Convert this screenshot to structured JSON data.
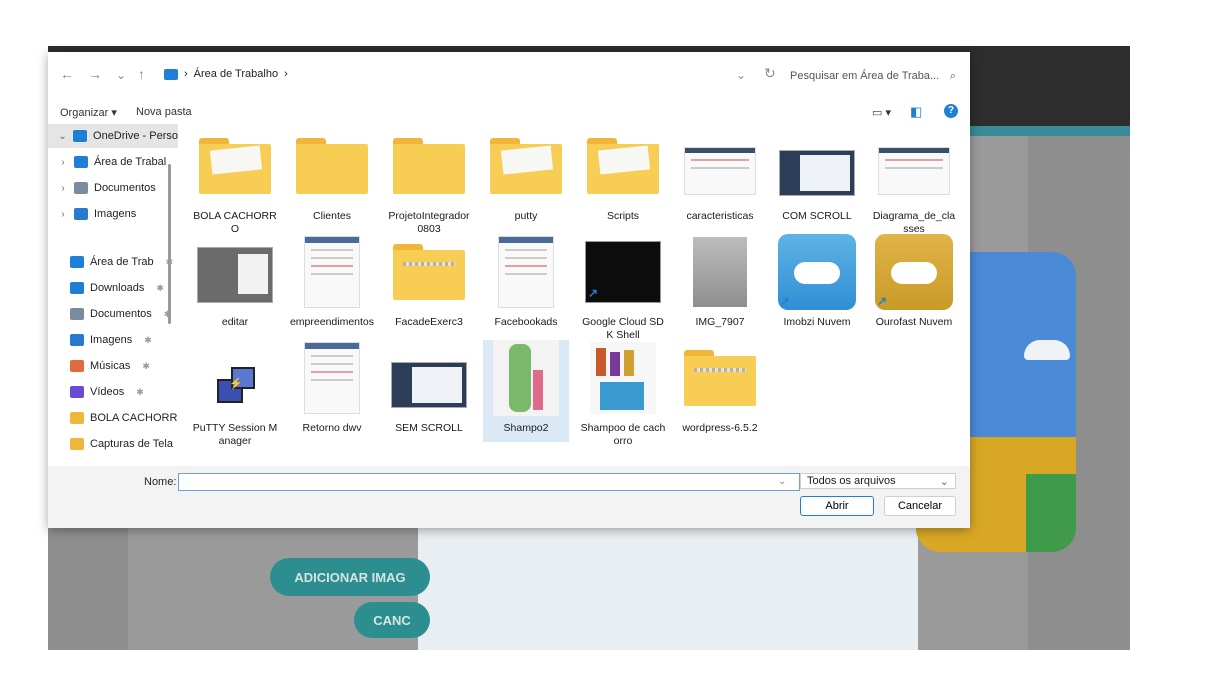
{
  "background_app": {
    "button_add": "ADICIONAR IMAG",
    "button_cancel": "CANC"
  },
  "nav": {
    "back": "←",
    "forward": "→",
    "recent": "⌄",
    "up": "↑",
    "breadcrumb_sep": "›",
    "breadcrumb": "Área de Trabalho",
    "dropdown": "⌄",
    "refresh": "↻",
    "search_placeholder": "Pesquisar em Área de Traba...",
    "search_icon": "⌕"
  },
  "toolbar": {
    "organize": "Organizar ▾",
    "new_folder": "Nova pasta",
    "view_icon": "▭ ▾",
    "preview_icon": "◧",
    "help_icon": "?"
  },
  "sidebar": {
    "items": [
      {
        "label": "OneDrive - Perso",
        "chev": "⌄",
        "icon": "onedrive-icon",
        "color": "#1f7fd6",
        "selected": true
      },
      {
        "label": "Área de Trabal",
        "chev": "›",
        "icon": "desktop-icon",
        "color": "#1f7fd6"
      },
      {
        "label": "Documentos",
        "chev": "›",
        "icon": "documents-icon",
        "color": "#7a8ba0"
      },
      {
        "label": "Imagens",
        "chev": "›",
        "icon": "images-icon",
        "color": "#2a79d0"
      },
      {
        "label": "Área de Trab",
        "pin": "📌",
        "icon": "desktop-icon",
        "color": "#1f7fd6"
      },
      {
        "label": "Downloads",
        "pin": "📌",
        "icon": "downloads-icon",
        "color": "#1f7fd6"
      },
      {
        "label": "Documentos",
        "pin": "📌",
        "icon": "documents-icon",
        "color": "#7a8ba0"
      },
      {
        "label": "Imagens",
        "pin": "📌",
        "icon": "images-icon",
        "color": "#2a79d0"
      },
      {
        "label": "Músicas",
        "pin": "📌",
        "icon": "music-icon",
        "color": "#e06a3b"
      },
      {
        "label": "Vídeos",
        "pin": "📌",
        "icon": "videos-icon",
        "color": "#6a4bd1"
      },
      {
        "label": "BOLA CACHORR",
        "icon": "folder-icon",
        "color": "#f0b63a"
      },
      {
        "label": "Capturas de Tela",
        "icon": "folder-icon",
        "color": "#f0b63a"
      }
    ]
  },
  "files": [
    {
      "label": "BOLA CACHORRO",
      "kind": "folder-paper"
    },
    {
      "label": "Clientes",
      "kind": "folder"
    },
    {
      "label": "ProjetoIntegrador0803",
      "kind": "folder"
    },
    {
      "label": "putty",
      "kind": "folder-paper"
    },
    {
      "label": "Scripts",
      "kind": "folder-paper"
    },
    {
      "label": "caracteristicas",
      "kind": "doc"
    },
    {
      "label": "COM SCROLL",
      "kind": "screenshot"
    },
    {
      "label": "Diagrama_de_classes",
      "kind": "doc"
    },
    {
      "label": "editar",
      "kind": "screenshot-gray"
    },
    {
      "label": "empreendimentos",
      "kind": "doc-tall"
    },
    {
      "label": "FacadeExerc3",
      "kind": "zip"
    },
    {
      "label": "Facebookads",
      "kind": "doc-tall"
    },
    {
      "label": "Google Cloud SDK Shell",
      "kind": "terminal",
      "shortcut": "↗"
    },
    {
      "label": "IMG_7907",
      "kind": "photo-gray"
    },
    {
      "label": "Imobzi Nuvem",
      "kind": "cloud-blue",
      "shortcut": "↗"
    },
    {
      "label": "Ourofast Nuvem",
      "kind": "cloud-gold",
      "shortcut": "↗"
    },
    {
      "label": "PuTTY Session Manager",
      "kind": "putty"
    },
    {
      "label": "Retorno dwv",
      "kind": "doc-tall"
    },
    {
      "label": "SEM SCROLL",
      "kind": "screenshot"
    },
    {
      "label": "Shampo2",
      "kind": "product",
      "selected": true
    },
    {
      "label": "Shampoo de cachorro",
      "kind": "product-multi"
    },
    {
      "label": "wordpress-6.5.2",
      "kind": "zip"
    }
  ],
  "bottom": {
    "name_label": "Nome:",
    "name_value": "",
    "filter": "Todos os arquivos",
    "filter_chevron": "⌄",
    "open": "Abrir",
    "cancel": "Cancelar"
  }
}
